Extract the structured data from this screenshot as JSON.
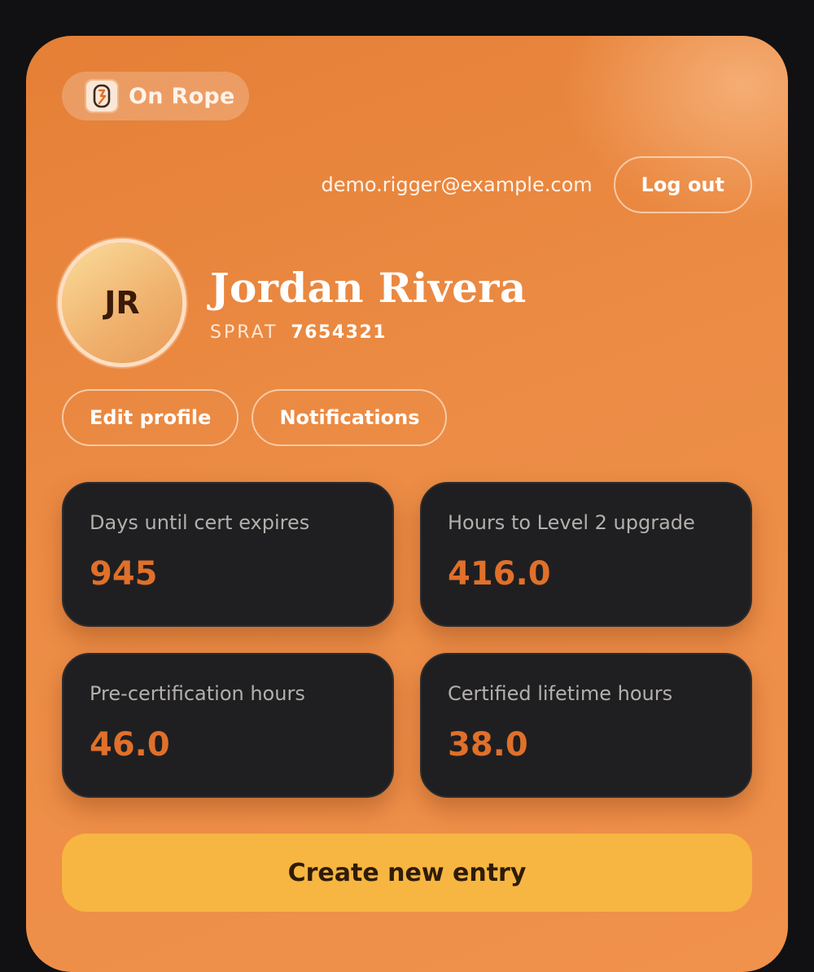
{
  "brand": {
    "name": "On Rope",
    "logo_icon": "carabiner-icon"
  },
  "account": {
    "email": "demo.rigger@example.com",
    "logout_label": "Log out"
  },
  "profile": {
    "initials": "JR",
    "name": "Jordan Rivera",
    "sprat_label": "SPRAT",
    "sprat_number": "7654321",
    "edit_label": "Edit profile",
    "notifications_label": "Notifications"
  },
  "stats": [
    {
      "label": "Days until cert expires",
      "value": "945"
    },
    {
      "label": "Hours to Level 2 upgrade",
      "value": "416.0"
    },
    {
      "label": "Pre-certification hours",
      "value": "46.0"
    },
    {
      "label": "Certified lifetime hours",
      "value": "38.0"
    }
  ],
  "cta": {
    "label": "Create new entry"
  },
  "colors": {
    "accent_orange": "#e0702a",
    "cta_yellow": "#f6b641",
    "stat_card_bg": "#1f1f21",
    "page_bg": "#111113"
  }
}
